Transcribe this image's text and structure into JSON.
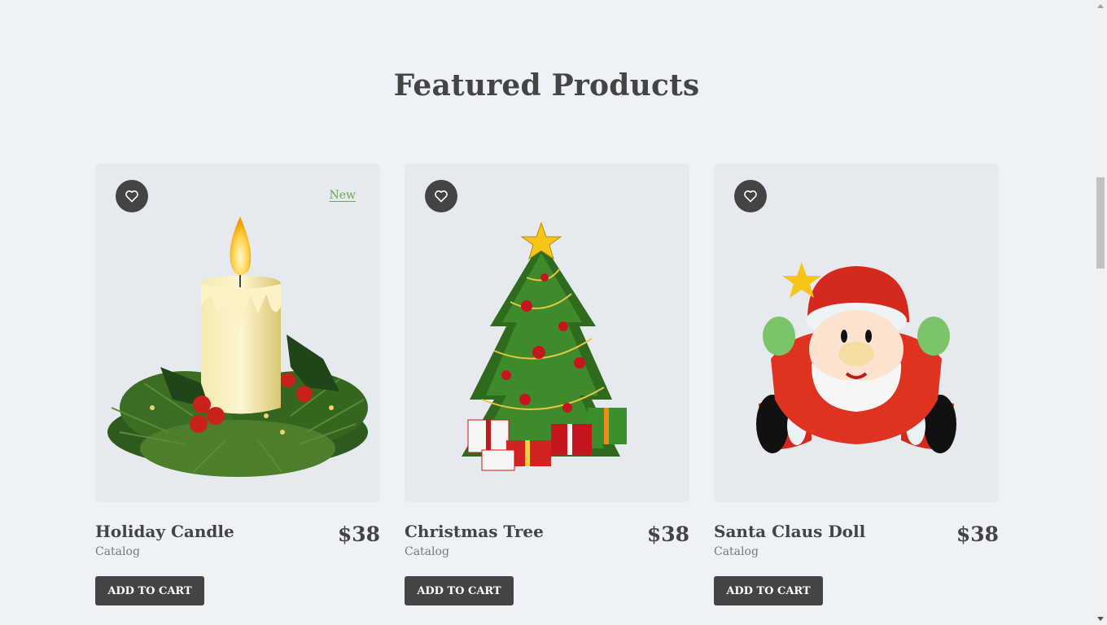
{
  "section": {
    "title": "Featured Products"
  },
  "products": [
    {
      "name": "Holiday Candle",
      "category": "Catalog",
      "price": "$38",
      "badge": "New",
      "cta": "ADD TO CART",
      "icon": "heart-icon"
    },
    {
      "name": "Christmas Tree",
      "category": "Catalog",
      "price": "$38",
      "cta": "ADD TO CART",
      "icon": "heart-icon"
    },
    {
      "name": "Santa Claus Doll",
      "category": "Catalog",
      "price": "$38",
      "cta": "ADD TO CART",
      "icon": "heart-icon"
    }
  ],
  "colors": {
    "background": "#eef1f5",
    "card": "#e6e9ee",
    "dark": "#444444",
    "badge": "#6aa84f"
  }
}
